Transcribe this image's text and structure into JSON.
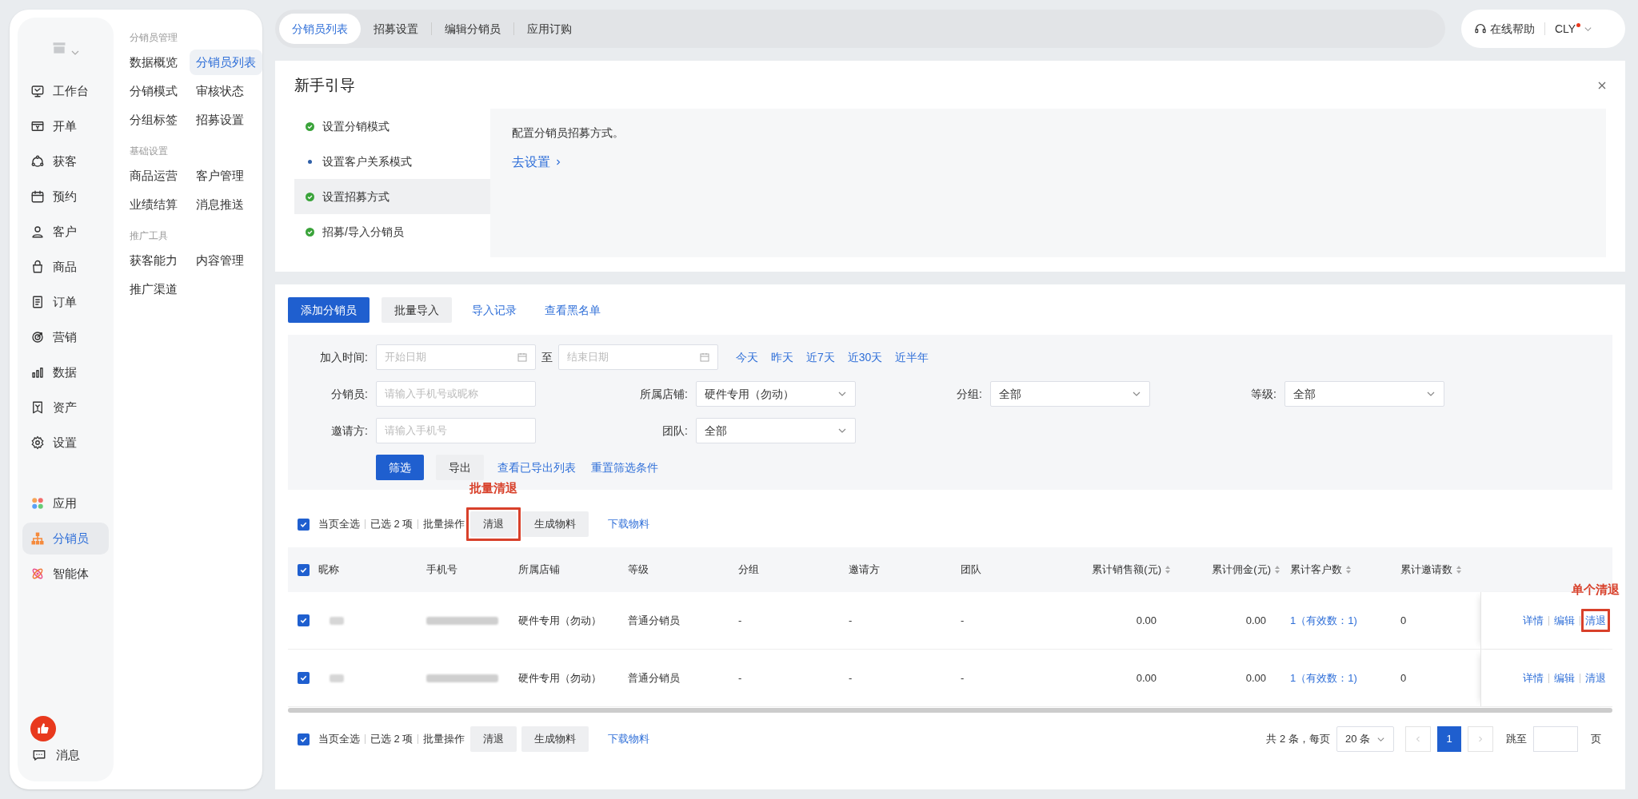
{
  "rail": {
    "items": [
      {
        "label": "工作台",
        "selected": false
      },
      {
        "label": "开单",
        "selected": false
      },
      {
        "label": "获客",
        "selected": false
      },
      {
        "label": "预约",
        "selected": false
      },
      {
        "label": "客户",
        "selected": false
      },
      {
        "label": "商品",
        "selected": false
      },
      {
        "label": "订单",
        "selected": false
      },
      {
        "label": "营销",
        "selected": false
      },
      {
        "label": "数据",
        "selected": false
      },
      {
        "label": "资产",
        "selected": false
      },
      {
        "label": "设置",
        "selected": false
      }
    ],
    "apps": [
      {
        "label": "应用",
        "selected": false
      },
      {
        "label": "分销员",
        "selected": true
      },
      {
        "label": "智能体",
        "selected": false
      }
    ],
    "message": {
      "label": "消息"
    }
  },
  "submenu": [
    {
      "title": "分销员管理",
      "items": [
        {
          "label": "数据概览",
          "selected": false
        },
        {
          "label": "分销员列表",
          "selected": true
        },
        {
          "label": "分销模式",
          "selected": false
        },
        {
          "label": "审核状态",
          "selected": false
        },
        {
          "label": "分组标签",
          "selected": false
        },
        {
          "label": "招募设置",
          "selected": false
        }
      ]
    },
    {
      "title": "基础设置",
      "items": [
        {
          "label": "商品运营",
          "selected": false
        },
        {
          "label": "客户管理",
          "selected": false
        },
        {
          "label": "业绩结算",
          "selected": false
        },
        {
          "label": "消息推送",
          "selected": false
        }
      ]
    },
    {
      "title": "推广工具",
      "items": [
        {
          "label": "获客能力",
          "selected": false
        },
        {
          "label": "内容管理",
          "selected": false
        },
        {
          "label": "推广渠道",
          "selected": false
        }
      ]
    }
  ],
  "tabs": [
    {
      "label": "分销员列表",
      "selected": true
    },
    {
      "label": "招募设置",
      "selected": false
    },
    {
      "label": "编辑分销员",
      "selected": false
    },
    {
      "label": "应用订购",
      "selected": false
    }
  ],
  "help": {
    "label": "在线帮助"
  },
  "user": {
    "name": "CLY",
    "unread": true
  },
  "guide": {
    "title": "新手引导",
    "steps": [
      {
        "label": "设置分销模式",
        "done": true,
        "selected": false
      },
      {
        "label": "设置客户关系模式",
        "done": false,
        "selected": false
      },
      {
        "label": "设置招募方式",
        "done": true,
        "selected": true
      },
      {
        "label": "招募/导入分销员",
        "done": true,
        "selected": false
      }
    ],
    "detail": "配置分销员招募方式。",
    "link": "去设置"
  },
  "actions": [
    {
      "label": "添加分销员",
      "kind": "primary"
    },
    {
      "label": "批量导入",
      "kind": "secondary"
    },
    {
      "label": "导入记录",
      "kind": "link"
    },
    {
      "label": "查看黑名单",
      "kind": "link"
    }
  ],
  "filters": {
    "join_time": {
      "label": "加入时间:",
      "start_placeholder": "开始日期",
      "separator": "至",
      "end_placeholder": "结束日期",
      "quick": [
        "今天",
        "昨天",
        "近7天",
        "近30天",
        "近半年"
      ]
    },
    "rows": [
      [
        {
          "label": "分销员:",
          "kind": "input",
          "placeholder": "请输入手机号或昵称"
        },
        {
          "label": "所属店铺:",
          "kind": "select",
          "value": "硬件专用（勿动）"
        },
        {
          "label": "分组:",
          "kind": "select",
          "value": "全部"
        },
        {
          "label": "等级:",
          "kind": "select",
          "value": "全部"
        }
      ],
      [
        {
          "label": "邀请方:",
          "kind": "input",
          "placeholder": "请输入手机号"
        },
        {
          "label": "团队:",
          "kind": "select",
          "value": "全部"
        }
      ]
    ],
    "buttons": [
      {
        "label": "筛选",
        "kind": "primary"
      },
      {
        "label": "导出",
        "kind": "secondary"
      },
      {
        "label": "查看已导出列表",
        "kind": "link"
      },
      {
        "label": "重置筛选条件",
        "kind": "link"
      }
    ]
  },
  "batch_bars": [
    {
      "select_all": "当页全选",
      "checked": true,
      "count": "已选 2 项",
      "batch_label": "批量操作",
      "buttons": [
        {
          "label": "清退",
          "annotation": "批量清退"
        },
        {
          "label": "生成物料"
        }
      ],
      "link": "下载物料"
    },
    {
      "select_all": "当页全选",
      "checked": true,
      "count": "已选 2 项",
      "batch_label": "批量操作",
      "buttons": [
        {
          "label": "清退"
        },
        {
          "label": "生成物料"
        }
      ],
      "link": "下载物料"
    }
  ],
  "table": {
    "all_checked": true,
    "columns": [
      {
        "label": "昵称",
        "sortable": false
      },
      {
        "label": "手机号",
        "sortable": false
      },
      {
        "label": "所属店铺",
        "sortable": false
      },
      {
        "label": "等级",
        "sortable": false
      },
      {
        "label": "分组",
        "sortable": false
      },
      {
        "label": "邀请方",
        "sortable": false
      },
      {
        "label": "团队",
        "sortable": false
      },
      {
        "label": "累计销售额(元)",
        "sortable": true
      },
      {
        "label": "累计佣金(元)",
        "sortable": true
      },
      {
        "label": "累计客户数",
        "sortable": true
      },
      {
        "label": "累计邀请数",
        "sortable": true
      }
    ],
    "rows": [
      {
        "checked": true,
        "cells": [
          "",
          "",
          "硬件专用（勿动）",
          "普通分销员",
          "-",
          "-",
          "-",
          "0.00",
          "0.00",
          "1（有效数：1)",
          "0"
        ],
        "actions": [
          {
            "label": "详情"
          },
          {
            "label": "编辑"
          },
          {
            "label": "清退",
            "annotation": "单个清退"
          }
        ]
      },
      {
        "checked": true,
        "cells": [
          "",
          "",
          "硬件专用（勿动）",
          "普通分销员",
          "-",
          "-",
          "-",
          "0.00",
          "0.00",
          "1（有效数：1)",
          "0"
        ],
        "actions": [
          {
            "label": "详情"
          },
          {
            "label": "编辑"
          },
          {
            "label": "清退"
          }
        ]
      }
    ]
  },
  "pagination": {
    "total": "共 2 条，每页",
    "page_size": "20 条",
    "pages": [
      {
        "label": "1",
        "selected": true
      }
    ],
    "jump": "跳至",
    "suffix": "页"
  }
}
